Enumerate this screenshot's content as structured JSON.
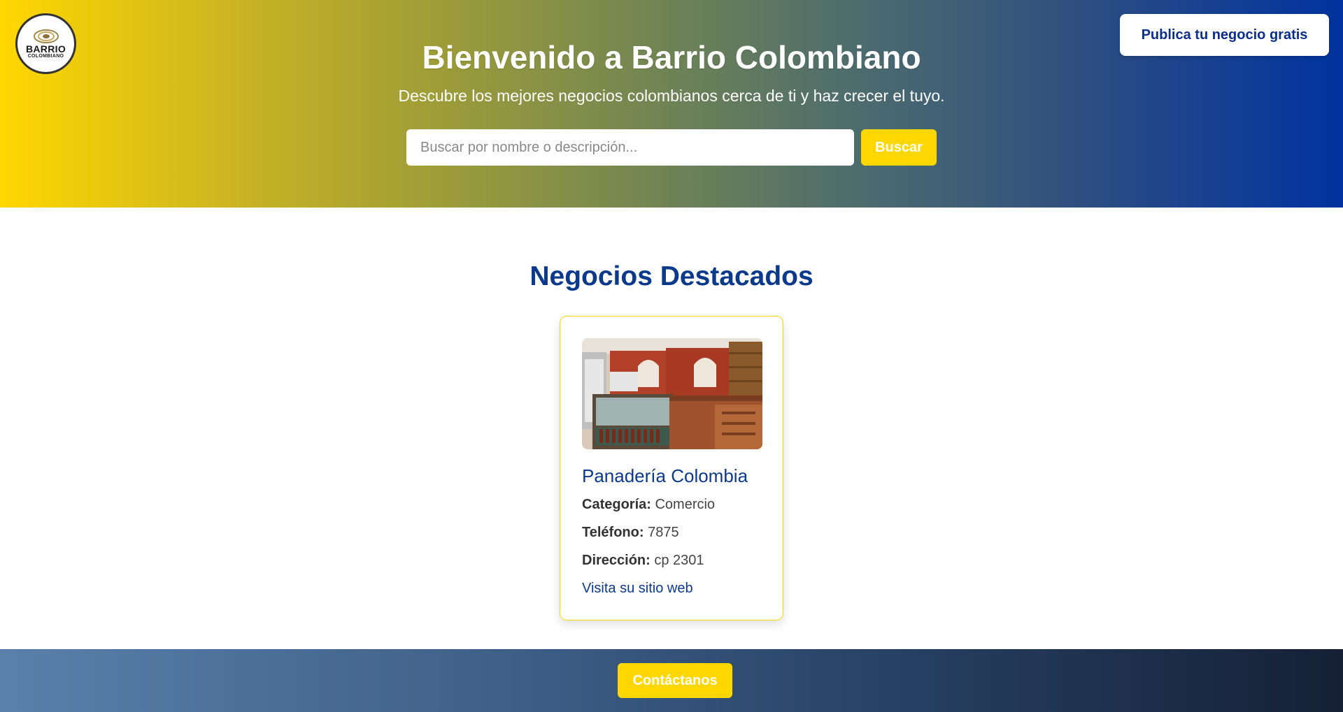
{
  "header": {
    "logo_text_1": "BARRIO",
    "logo_text_2": "COLOMBIANO",
    "publish_label": "Publica tu negocio gratis",
    "title": "Bienvenido a Barrio Colombiano",
    "subtitle": "Descubre los mejores negocios colombianos cerca de ti y haz crecer el tuyo.",
    "search_placeholder": "Buscar por nombre o descripción...",
    "search_label": "Buscar"
  },
  "featured": {
    "title": "Negocios Destacados",
    "card": {
      "name": "Panadería Colombia",
      "category_label": "Categoría:",
      "category": "Comercio",
      "phone_label": "Teléfono:",
      "phone": "7875",
      "address_label": "Dirección:",
      "address": "cp 2301",
      "website_label": "Visita su sitio web"
    }
  },
  "footer": {
    "contact_label": "Contáctanos"
  },
  "colors": {
    "brand_blue": "#0b3a8c",
    "brand_yellow": "#ffd700"
  }
}
